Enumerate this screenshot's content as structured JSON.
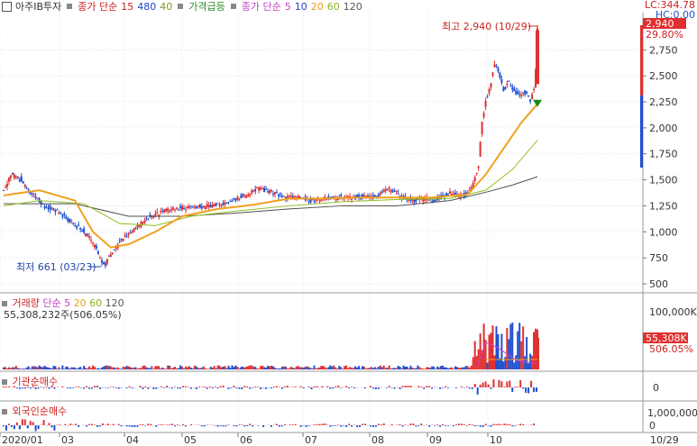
{
  "header": {
    "stock_name": "아주IB투자",
    "ma_label": "종가 단순",
    "ma_periods": [
      "15",
      "480",
      "40"
    ],
    "price_alert": "가격급등",
    "ma2_label": "종가 단순",
    "ma2_periods": [
      "5",
      "10",
      "20",
      "60",
      "120"
    ]
  },
  "corner": {
    "lc": "LC:344.78",
    "hc": "HC:0.00"
  },
  "price_labels": {
    "last": "2,940",
    "pct": "29.80%"
  },
  "annotations": {
    "high": "최고 2,940 (10/29)",
    "low": "최저 661 (03/23)"
  },
  "volume_panel": {
    "label": "거래량",
    "ma_label": "단순",
    "ma_periods": [
      "5",
      "20",
      "60",
      "120"
    ],
    "value_text": "55,308,232주(506.05%)",
    "axis_top": "100,000K",
    "last_tag": "55,308K",
    "last_pct": "506.05%"
  },
  "inst_panel": {
    "label": "기관순매수",
    "axis_zero": "0"
  },
  "foreign_panel": {
    "label": "외국인순매수",
    "axis_top": "1,000,000",
    "axis_zero": "0"
  },
  "colors": {
    "up": "#e03030",
    "down": "#2050d0",
    "ma5": "#d040d0",
    "ma10": "#2040c0",
    "ma20": "#f0a020",
    "ma60": "#90c020",
    "ma120": "#505050"
  },
  "chart_data": {
    "type": "candlestick",
    "x_axis": [
      "2020/01",
      "03",
      "04",
      "05",
      "06",
      "07",
      "08",
      "09",
      "10",
      "10/29"
    ],
    "y_ticks": [
      "2,750",
      "2,500",
      "2,250",
      "2,000",
      "1,750",
      "1,500",
      "1,250",
      "1,000",
      "750",
      "500"
    ],
    "ylim": [
      500,
      2900
    ],
    "high": {
      "value": 2940,
      "date": "10/29"
    },
    "low": {
      "value": 661,
      "date": "03/23"
    },
    "close_path": [
      [
        0,
        1400
      ],
      [
        8,
        1550
      ],
      [
        20,
        1500
      ],
      [
        30,
        1380
      ],
      [
        45,
        1250
      ],
      [
        60,
        1200
      ],
      [
        75,
        1100
      ],
      [
        90,
        1000
      ],
      [
        100,
        900
      ],
      [
        110,
        720
      ],
      [
        114,
        680
      ],
      [
        118,
        760
      ],
      [
        125,
        850
      ],
      [
        135,
        950
      ],
      [
        150,
        1050
      ],
      [
        165,
        1150
      ],
      [
        180,
        1200
      ],
      [
        200,
        1230
      ],
      [
        220,
        1240
      ],
      [
        240,
        1260
      ],
      [
        255,
        1300
      ],
      [
        270,
        1350
      ],
      [
        285,
        1420
      ],
      [
        300,
        1380
      ],
      [
        315,
        1330
      ],
      [
        330,
        1340
      ],
      [
        345,
        1300
      ],
      [
        360,
        1320
      ],
      [
        380,
        1330
      ],
      [
        400,
        1330
      ],
      [
        420,
        1340
      ],
      [
        430,
        1420
      ],
      [
        440,
        1380
      ],
      [
        450,
        1320
      ],
      [
        460,
        1300
      ],
      [
        470,
        1330
      ],
      [
        480,
        1300
      ],
      [
        490,
        1330
      ],
      [
        500,
        1380
      ],
      [
        515,
        1350
      ],
      [
        525,
        1420
      ],
      [
        532,
        1650
      ],
      [
        536,
        2050
      ],
      [
        540,
        2250
      ],
      [
        545,
        2400
      ],
      [
        550,
        2620
      ],
      [
        554,
        2560
      ],
      [
        560,
        2350
      ],
      [
        565,
        2450
      ],
      [
        570,
        2380
      ],
      [
        578,
        2300
      ],
      [
        585,
        2350
      ],
      [
        590,
        2250
      ],
      [
        595,
        2400
      ],
      [
        598,
        2940
      ]
    ],
    "ma20_path": [
      [
        0,
        1350
      ],
      [
        40,
        1400
      ],
      [
        80,
        1300
      ],
      [
        100,
        1000
      ],
      [
        120,
        850
      ],
      [
        140,
        880
      ],
      [
        170,
        1000
      ],
      [
        200,
        1150
      ],
      [
        240,
        1220
      ],
      [
        280,
        1260
      ],
      [
        320,
        1320
      ],
      [
        360,
        1320
      ],
      [
        400,
        1330
      ],
      [
        440,
        1330
      ],
      [
        480,
        1330
      ],
      [
        520,
        1360
      ],
      [
        540,
        1550
      ],
      [
        560,
        1800
      ],
      [
        580,
        2050
      ],
      [
        598,
        2230
      ]
    ],
    "ma60_path": [
      [
        0,
        1250
      ],
      [
        40,
        1300
      ],
      [
        90,
        1270
      ],
      [
        130,
        1080
      ],
      [
        170,
        1060
      ],
      [
        210,
        1150
      ],
      [
        260,
        1200
      ],
      [
        320,
        1250
      ],
      [
        380,
        1290
      ],
      [
        440,
        1310
      ],
      [
        500,
        1320
      ],
      [
        540,
        1400
      ],
      [
        570,
        1600
      ],
      [
        598,
        1880
      ]
    ],
    "ma120_path": [
      [
        0,
        1270
      ],
      [
        80,
        1270
      ],
      [
        140,
        1150
      ],
      [
        200,
        1150
      ],
      [
        260,
        1180
      ],
      [
        320,
        1220
      ],
      [
        380,
        1250
      ],
      [
        440,
        1250
      ],
      [
        500,
        1300
      ],
      [
        540,
        1380
      ],
      [
        570,
        1450
      ],
      [
        598,
        1530
      ]
    ]
  }
}
